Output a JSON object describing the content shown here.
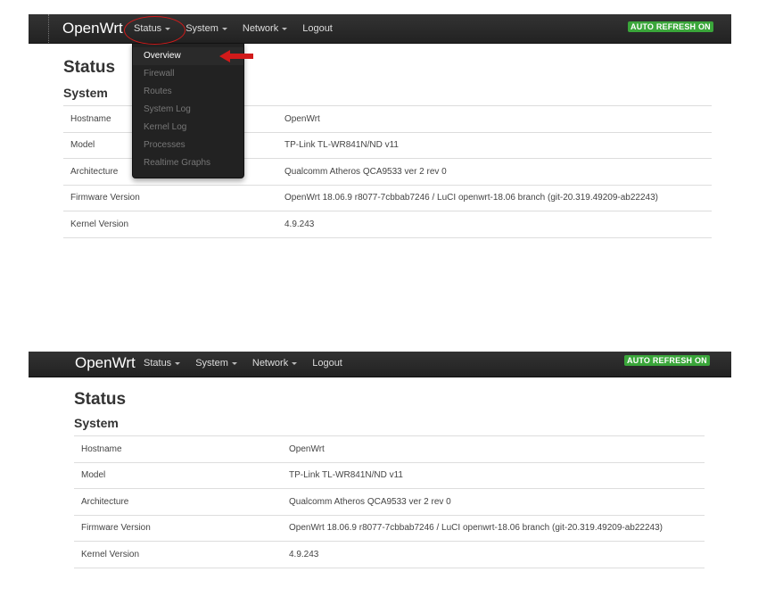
{
  "top": {
    "brand": "OpenWrt",
    "menu": [
      {
        "label": "Status"
      },
      {
        "label": "System"
      },
      {
        "label": "Network"
      },
      {
        "label": "Logout"
      }
    ],
    "auto_refresh": "AUTO REFRESH ON",
    "status_dropdown": [
      "Overview",
      "Firewall",
      "Routes",
      "System Log",
      "Kernel Log",
      "Processes",
      "Realtime Graphs"
    ],
    "page_title": "Status",
    "section_title": "System",
    "rows": [
      {
        "key": "Hostname",
        "value": "OpenWrt"
      },
      {
        "key": "Model",
        "value": "TP-Link TL-WR841N/ND v11"
      },
      {
        "key": "Architecture",
        "value": "Qualcomm Atheros QCA9533 ver 2 rev 0"
      },
      {
        "key": "Firmware Version",
        "value": "OpenWrt 18.06.9 r8077-7cbbab7246 / LuCI openwrt-18.06 branch (git-20.319.49209-ab22243)"
      },
      {
        "key": "Kernel Version",
        "value": "4.9.243"
      }
    ]
  },
  "bottom": {
    "brand": "OpenWrt",
    "menu": [
      {
        "label": "Status"
      },
      {
        "label": "System"
      },
      {
        "label": "Network"
      },
      {
        "label": "Logout"
      }
    ],
    "auto_refresh": "AUTO REFRESH ON",
    "page_title": "Status",
    "section_title": "System",
    "rows": [
      {
        "key": "Hostname",
        "value": "OpenWrt"
      },
      {
        "key": "Model",
        "value": "TP-Link TL-WR841N/ND v11"
      },
      {
        "key": "Architecture",
        "value": "Qualcomm Atheros QCA9533 ver 2 rev 0"
      },
      {
        "key": "Firmware Version",
        "value": "OpenWrt 18.06.9 r8077-7cbbab7246 / LuCI openwrt-18.06 branch (git-20.319.49209-ab22243)"
      },
      {
        "key": "Kernel Version",
        "value": "4.9.243"
      }
    ]
  },
  "colors": {
    "navbar": "#222222",
    "auto_refresh_bg": "#3aa63a",
    "annotation": "#d11a1a"
  },
  "icons": {
    "caret": "caret-down-icon",
    "annotation_arrow": "arrow-left-icon"
  }
}
